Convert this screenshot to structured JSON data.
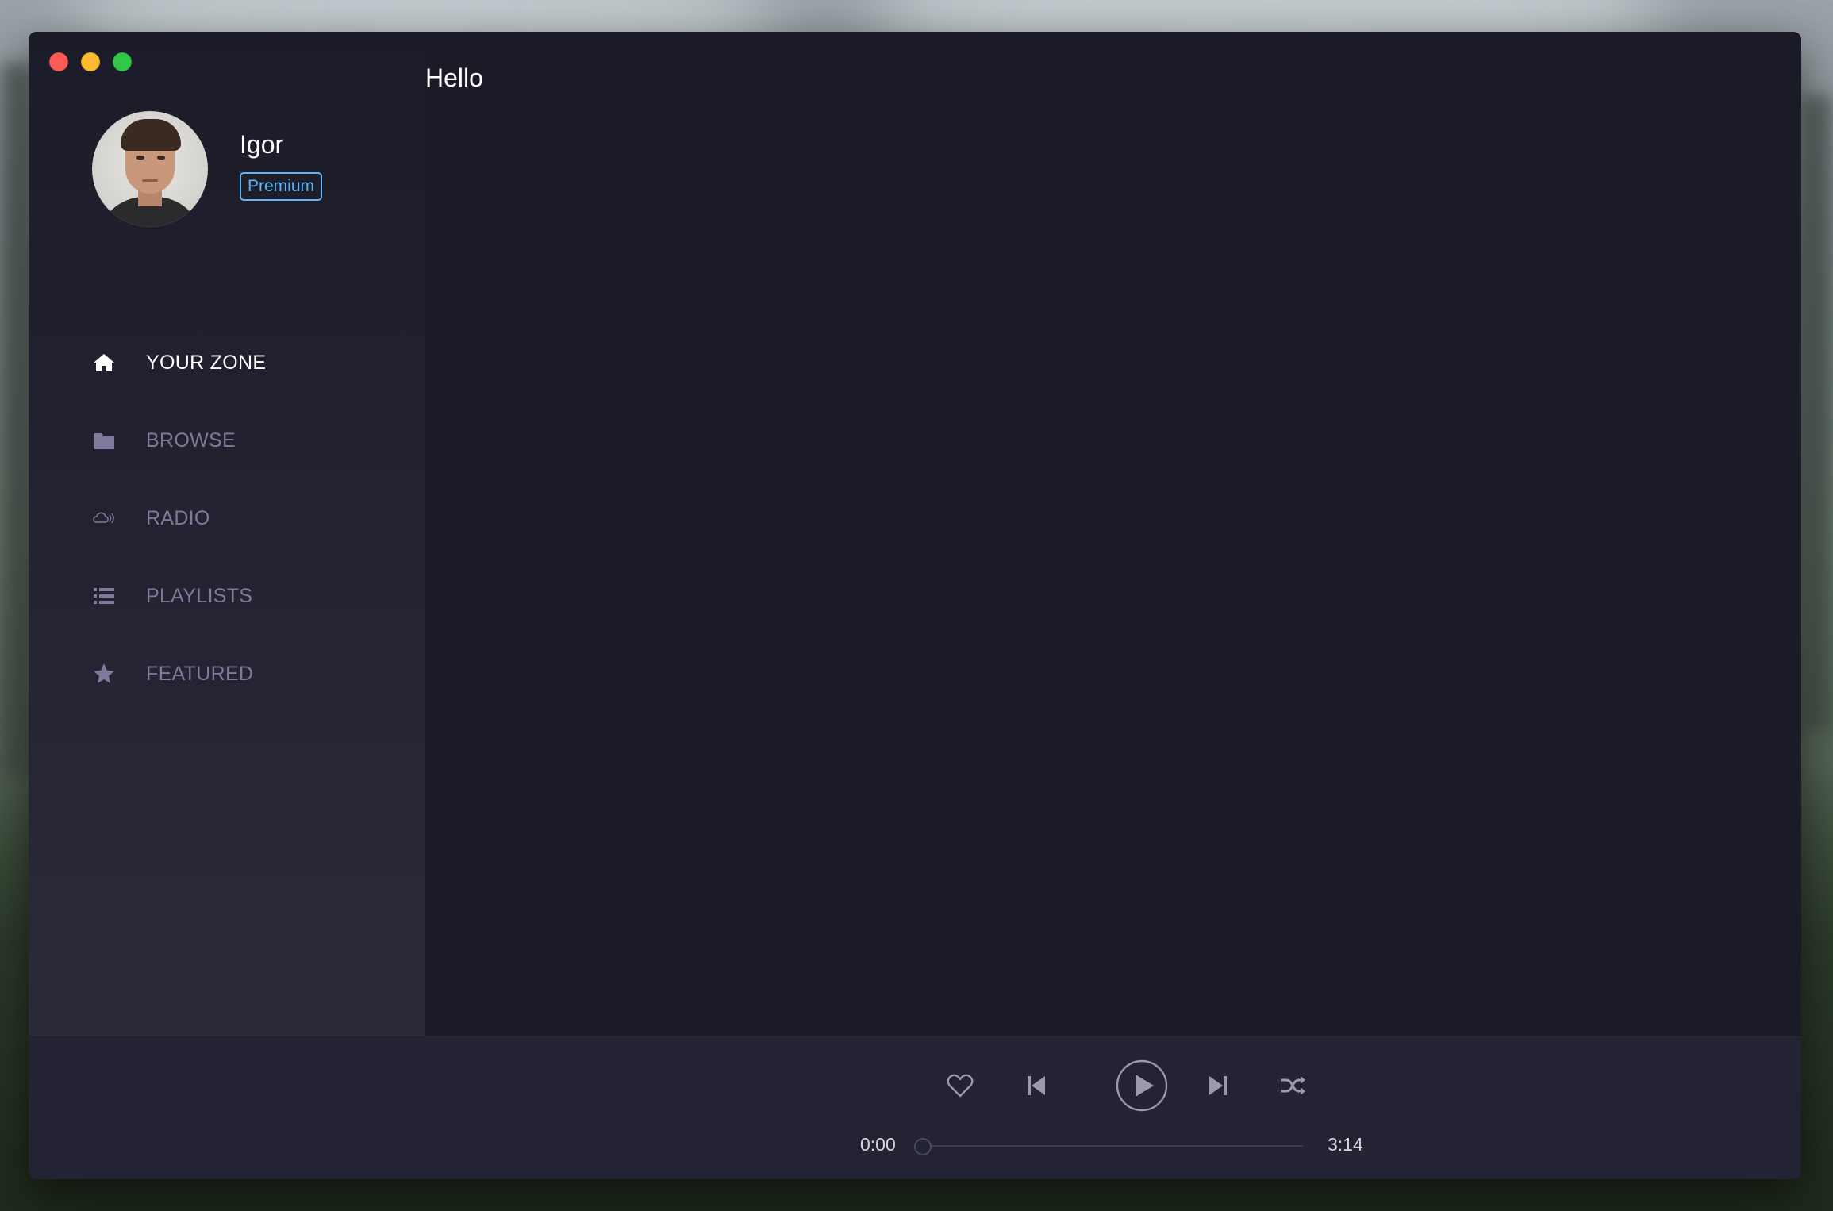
{
  "window": {
    "greeting": "Hello"
  },
  "profile": {
    "name": "Igor",
    "plan_badge": "Premium"
  },
  "nav": {
    "items": [
      {
        "label": "YOUR ZONE",
        "icon": "home-icon",
        "active": true
      },
      {
        "label": "BROWSE",
        "icon": "folder-icon",
        "active": false
      },
      {
        "label": "RADIO",
        "icon": "cloud-radio-icon",
        "active": false
      },
      {
        "label": "PLAYLISTS",
        "icon": "list-icon",
        "active": false
      },
      {
        "label": "FEATURED",
        "icon": "star-icon",
        "active": false
      }
    ]
  },
  "player": {
    "current_time": "0:00",
    "total_time": "3:14",
    "progress": 0,
    "controls": [
      "heart-icon",
      "previous-icon",
      "play-icon",
      "next-icon",
      "shuffle-icon"
    ]
  },
  "colors": {
    "window_bg": "#1b1b28",
    "sidebar_bg": "#232331",
    "player_bg": "#232333",
    "nav_inactive": "#7d7a9b",
    "nav_active": "#ffffff",
    "premium_accent": "#5ab4f5",
    "control_icon": "#9a99ad"
  }
}
